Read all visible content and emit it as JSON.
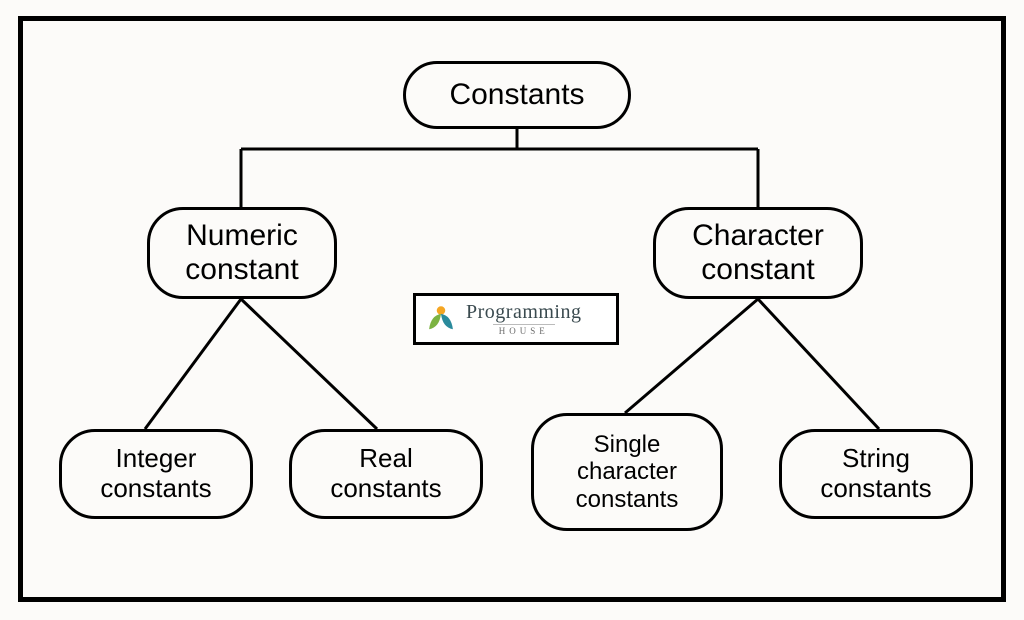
{
  "tree": {
    "root": {
      "label": "Constants"
    },
    "level2": {
      "left": {
        "label": "Numeric\nconstant"
      },
      "right": {
        "label": "Character\nconstant"
      }
    },
    "level3": {
      "l1": {
        "label": "Integer\nconstants"
      },
      "l2": {
        "label": "Real\nconstants"
      },
      "r1": {
        "label": "Single\ncharacter\nconstants"
      },
      "r2": {
        "label": "String\nconstants"
      }
    }
  },
  "logo": {
    "main": "Programming",
    "sub": "HOUSE"
  }
}
